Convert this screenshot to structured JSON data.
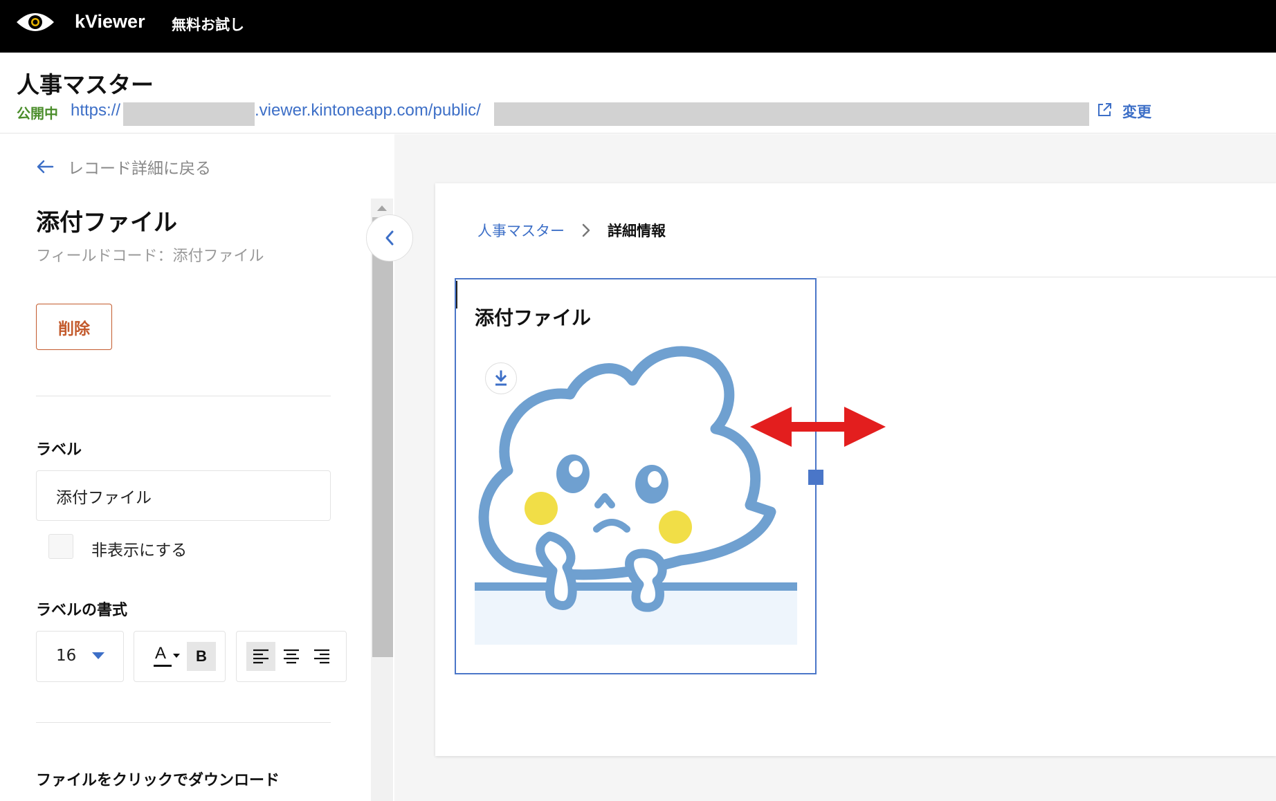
{
  "topbar": {
    "brand": "kViewer",
    "trial": "無料お試し"
  },
  "header": {
    "title": "人事マスター",
    "status": "公開中",
    "url_prefix": "https://",
    "url_middle": ".viewer.kintoneapp.com/public/",
    "change_label": "変更"
  },
  "sidebar": {
    "back_label": "レコード詳細に戻る",
    "field_title": "添付ファイル",
    "field_code": "フィールドコード：添付ファイル",
    "delete_label": "削除",
    "label_section": "ラベル",
    "label_value": "添付ファイル",
    "hide_label": "非表示にする",
    "format_section": "ラベルの書式",
    "font_size": "16",
    "color_btn": "A",
    "bold_btn": "B",
    "download_section": "ファイルをクリックでダウンロード"
  },
  "main": {
    "breadcrumb_parent": "人事マスター",
    "breadcrumb_current": "詳細情報",
    "field_label": "添付ファイル"
  },
  "colors": {
    "accent": "#3d6fc7",
    "danger": "#c35a2c",
    "published": "#4a8d2a",
    "arrow": "#e31e1e",
    "illustration_line": "#6fa0d0",
    "cheek": "#f1de47"
  }
}
